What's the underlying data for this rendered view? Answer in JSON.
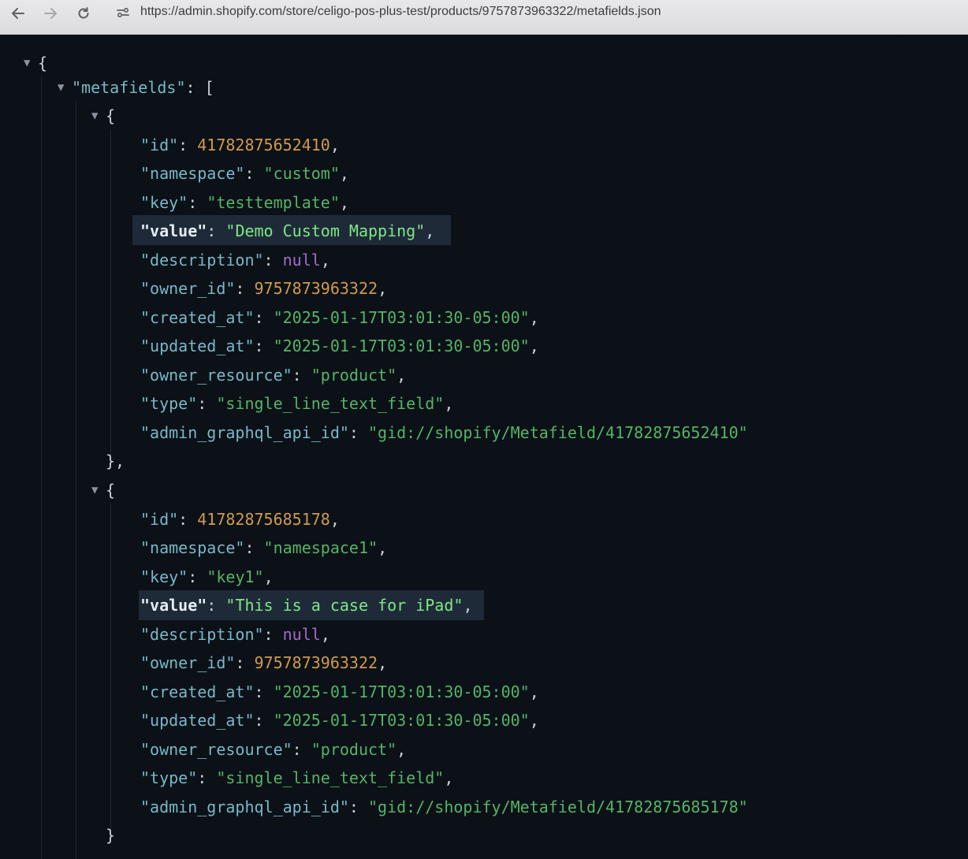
{
  "browser": {
    "url": "https://admin.shopify.com/store/celigo-pos-plus-test/products/9757873963322/metafields.json",
    "icons": [
      "back-arrow-icon",
      "forward-arrow-icon",
      "reload-icon",
      "site-settings-icon"
    ]
  },
  "json": {
    "root_key": "metafields",
    "metafields": [
      {
        "id": "41782875652410",
        "namespace": "custom",
        "key": "testtemplate",
        "value": "Demo Custom Mapping",
        "description": "null",
        "owner_id": "9757873963322",
        "created_at": "2025-01-17T03:01:30-05:00",
        "updated_at": "2025-01-17T03:01:30-05:00",
        "owner_resource": "product",
        "type": "single_line_text_field",
        "admin_graphql_api_id": "gid://shopify/Metafield/41782875652410"
      },
      {
        "id": "41782875685178",
        "namespace": "namespace1",
        "key": "key1",
        "value": "This is a case for iPad",
        "description": "null",
        "owner_id": "9757873963322",
        "created_at": "2025-01-17T03:01:30-05:00",
        "updated_at": "2025-01-17T03:01:30-05:00",
        "owner_resource": "product",
        "type": "single_line_text_field",
        "admin_graphql_api_id": "gid://shopify/Metafield/41782875685178"
      }
    ]
  },
  "colors": {
    "background": "#0b1117",
    "key": "#79b8c8",
    "string": "#56b368",
    "number": "#d19a4e",
    "null": "#a36ac7",
    "highlight": "#1f2a38"
  }
}
